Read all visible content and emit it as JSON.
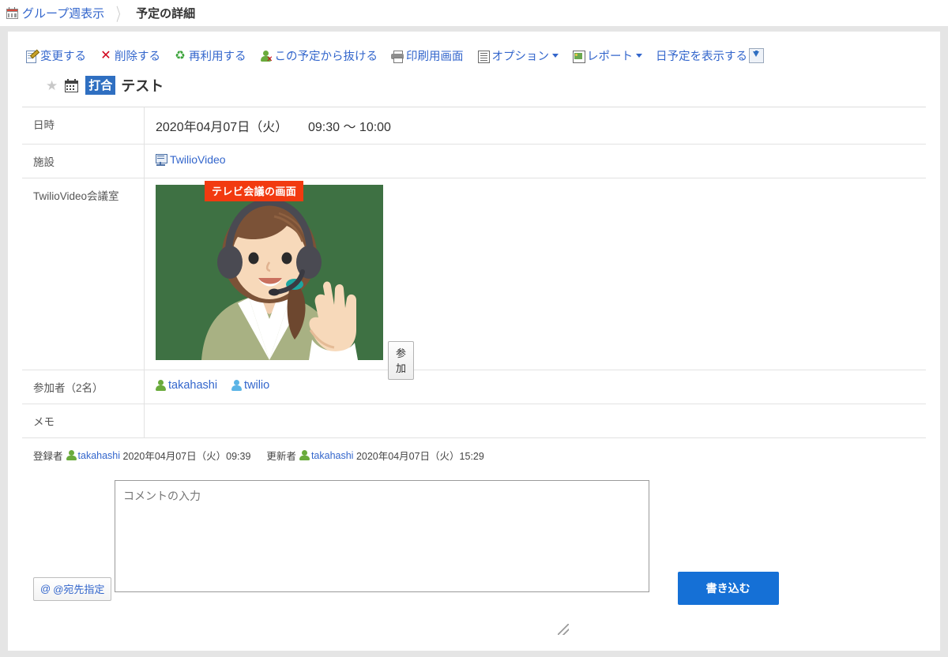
{
  "breadcrumb": {
    "icon": "calendar-icon",
    "link_label": "グループ週表示",
    "separator": "〉",
    "current_label": "予定の詳細"
  },
  "toolbar": {
    "items": [
      {
        "icon": "edit-icon",
        "label": "変更する",
        "has_caret": false
      },
      {
        "icon": "delete-icon",
        "label": "削除する",
        "has_caret": false
      },
      {
        "icon": "reuse-icon",
        "label": "再利用する",
        "has_caret": false
      },
      {
        "icon": "leave-icon",
        "label": "この予定から抜ける",
        "has_caret": false
      },
      {
        "icon": "print-icon",
        "label": "印刷用画面",
        "has_caret": false
      },
      {
        "icon": "options-icon",
        "label": "オプション",
        "has_caret": true
      },
      {
        "icon": "report-icon",
        "label": "レポート",
        "has_caret": true
      },
      {
        "icon": "download-icon",
        "label": "日予定を表示する",
        "has_caret": false
      }
    ]
  },
  "title": {
    "star_icon": "star-icon",
    "calendar_icon": "calendar-icon",
    "badge": "打合",
    "text": "テスト"
  },
  "detail": {
    "rows": [
      {
        "label": "日時",
        "type": "datetime"
      },
      {
        "label": "施設",
        "type": "facility"
      },
      {
        "label": "TwilioVideo会議室",
        "type": "video"
      },
      {
        "label": "参加者（2名）",
        "type": "attendees"
      },
      {
        "label": "メモ",
        "type": "empty"
      }
    ],
    "datetime": {
      "date": "2020年04月07日（火）",
      "time": "09:30 〜 10:00"
    },
    "facility": {
      "icon": "facility-icon",
      "name": "TwilioVideo"
    },
    "video": {
      "annotation_badge": "テレビ会議の画面",
      "annotation_color": "#f23a10",
      "background_color": "#3e7143",
      "join_button": "参加"
    },
    "attendees": [
      {
        "name": "takahashi",
        "icon_color": "#6aab3c"
      },
      {
        "name": "twilio",
        "icon_color": "#5ab4e6"
      }
    ],
    "memo_value": ""
  },
  "meta": {
    "creator_label": "登録者",
    "creator_name": "takahashi",
    "creator_datetime": "2020年04月07日（火）09:39",
    "updater_label": "更新者",
    "updater_name": "takahashi",
    "updater_datetime": "2020年04月07日（火）15:29"
  },
  "comment": {
    "address_button": "@宛先指定",
    "at_symbol": "@",
    "placeholder": "コメントの入力",
    "value": "",
    "submit_label": "書き込む",
    "submit_color": "#1570d6"
  }
}
